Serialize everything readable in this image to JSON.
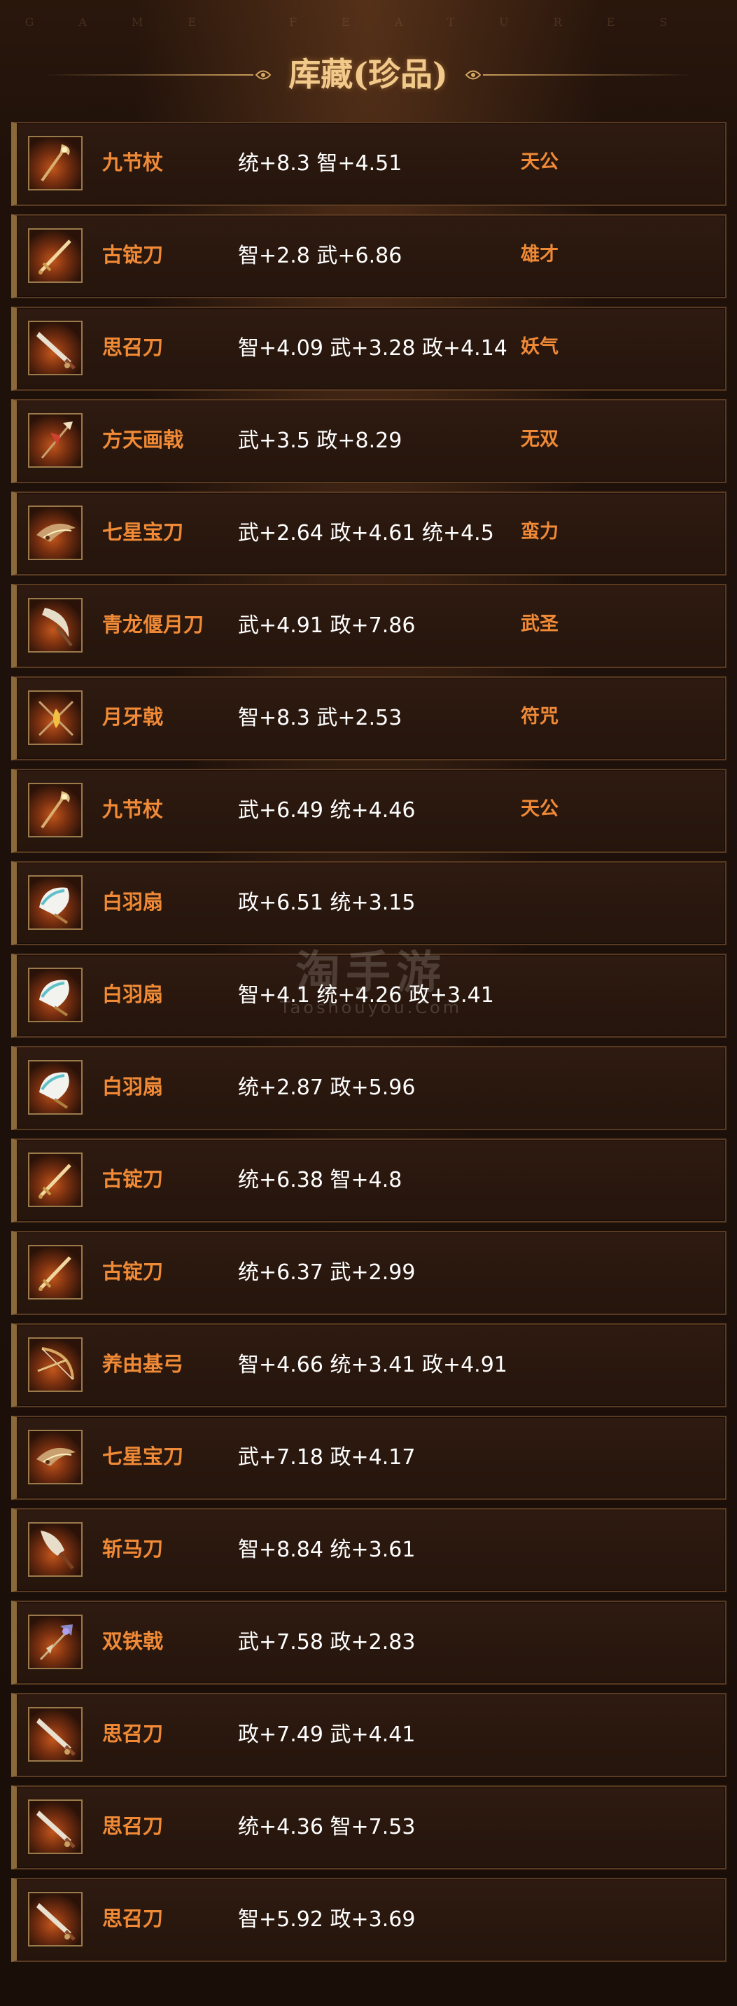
{
  "header": {
    "top_letters": "GAME FEATURES",
    "title": "库藏(珍品)"
  },
  "items": [
    {
      "icon": "staff-icon",
      "name": "九节杖",
      "stats": "统+8.3 智+4.51",
      "trait": "天公"
    },
    {
      "icon": "sword-icon",
      "name": "古锭刀",
      "stats": "智+2.8 武+6.86",
      "trait": "雄才"
    },
    {
      "icon": "blade-icon",
      "name": "思召刀",
      "stats": "智+4.09 武+3.28 政+4.14",
      "trait": "妖气"
    },
    {
      "icon": "halberd-icon",
      "name": "方天画戟",
      "stats": "武+3.5 政+8.29",
      "trait": "无双"
    },
    {
      "icon": "dragon-blade-icon",
      "name": "七星宝刀",
      "stats": "武+2.64 政+4.61 统+4.5",
      "trait": "蛮力"
    },
    {
      "icon": "glaive-icon",
      "name": "青龙偃月刀",
      "stats": "武+4.91 政+7.86",
      "trait": "武圣"
    },
    {
      "icon": "crescent-halberd-icon",
      "name": "月牙戟",
      "stats": "智+8.3 武+2.53",
      "trait": "符咒"
    },
    {
      "icon": "staff-icon",
      "name": "九节杖",
      "stats": "武+6.49 统+4.46",
      "trait": "天公"
    },
    {
      "icon": "feather-fan-icon",
      "name": "白羽扇",
      "stats": "政+6.51 统+3.15",
      "trait": ""
    },
    {
      "icon": "feather-fan-icon",
      "name": "白羽扇",
      "stats": "智+4.1 统+4.26 政+3.41",
      "trait": ""
    },
    {
      "icon": "feather-fan-icon",
      "name": "白羽扇",
      "stats": "统+2.87 政+5.96",
      "trait": ""
    },
    {
      "icon": "sword-icon",
      "name": "古锭刀",
      "stats": "统+6.38 智+4.8",
      "trait": ""
    },
    {
      "icon": "sword-icon",
      "name": "古锭刀",
      "stats": "统+6.37 武+2.99",
      "trait": ""
    },
    {
      "icon": "bow-icon",
      "name": "养由基弓",
      "stats": "智+4.66 统+3.41 政+4.91",
      "trait": ""
    },
    {
      "icon": "dragon-blade-icon",
      "name": "七星宝刀",
      "stats": "武+7.18 政+4.17",
      "trait": ""
    },
    {
      "icon": "broad-blade-icon",
      "name": "斩马刀",
      "stats": "智+8.84 统+3.61",
      "trait": ""
    },
    {
      "icon": "twin-halberd-icon",
      "name": "双铁戟",
      "stats": "武+7.58 政+2.83",
      "trait": ""
    },
    {
      "icon": "blade-icon",
      "name": "思召刀",
      "stats": "政+7.49 武+4.41",
      "trait": ""
    },
    {
      "icon": "blade-icon",
      "name": "思召刀",
      "stats": "统+4.36 智+7.53",
      "trait": ""
    },
    {
      "icon": "blade-icon",
      "name": "思召刀",
      "stats": "智+5.92 政+3.69",
      "trait": ""
    }
  ],
  "watermark": {
    "main": "淘手游",
    "sub": "Taoshouyou.Com"
  },
  "colors": {
    "name": "#f08a36",
    "stats": "#ffffff",
    "title": "#f1c98b",
    "border": "#5a3a20"
  }
}
